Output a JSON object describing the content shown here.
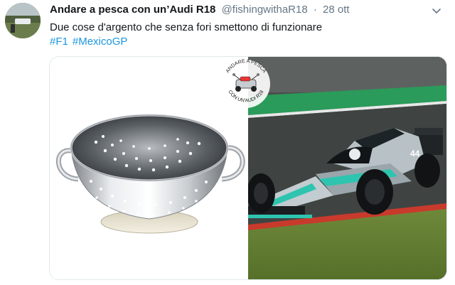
{
  "tweet": {
    "display_name": "Andare a pesca con un’Audi R18",
    "handle": "@fishingwithaR18",
    "separator": "·",
    "time": "28 ott",
    "text": "Due cose d'argento che senza fori smettono di funzionare",
    "hashtags": [
      "#F1",
      "#MexicoGP"
    ]
  },
  "media": {
    "left_image": "colander",
    "right_image": "formula-1-car",
    "watermark_top": "ANDARE A PESCA",
    "watermark_bottom": "CON UN'AUDI R18"
  },
  "icons": {
    "menu": "chevron-down-icon"
  },
  "colors": {
    "link": "#1b95e0",
    "muted": "#657786",
    "text": "#14171a",
    "border": "#e1e8ed"
  }
}
